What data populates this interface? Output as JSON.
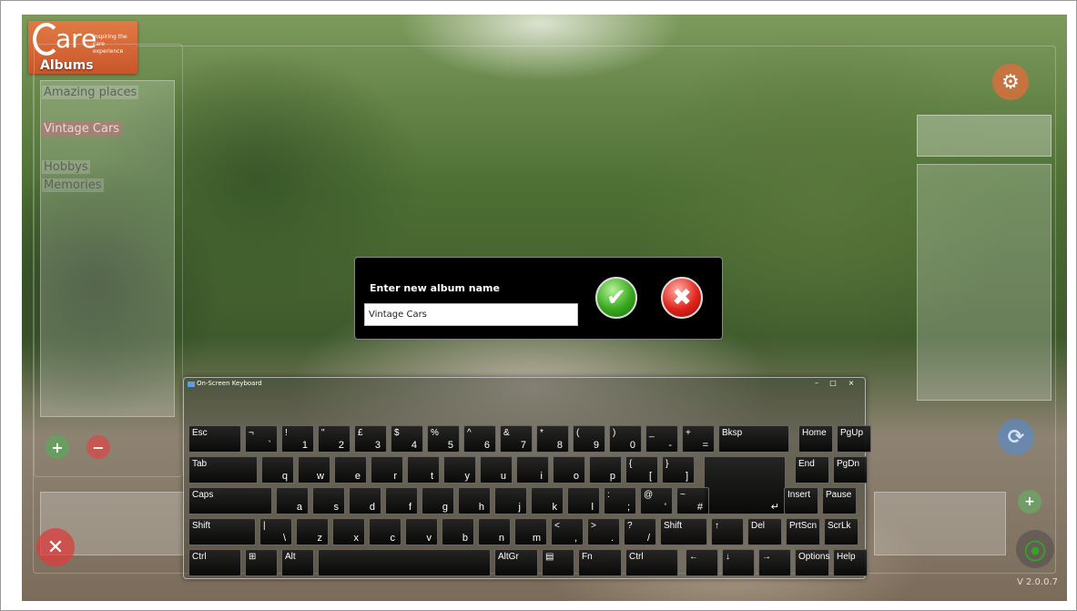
{
  "app": {
    "logo_word": "are",
    "logo_tagline": "inspiring the care experience",
    "albums_title": "Albums",
    "version": "V 2.0.0.7"
  },
  "albums": {
    "items": [
      "Amazing places",
      "Vintage Cars",
      "Hobbys",
      "Memories"
    ]
  },
  "dialog": {
    "title": "Enter new album name",
    "input_value": "Vintage Cars",
    "ok_icon": "checkmark-icon",
    "cancel_icon": "close-icon"
  },
  "osk": {
    "title": "On-Screen Keyboard",
    "controls": [
      "–",
      "□",
      "×"
    ],
    "rows": [
      [
        {
          "top": "Esc",
          "bottom": ""
        },
        {
          "top": "¬",
          "bottom": "`"
        },
        {
          "top": "!",
          "bottom": "1"
        },
        {
          "top": "\"",
          "bottom": "2"
        },
        {
          "top": "£",
          "bottom": "3"
        },
        {
          "top": "$",
          "bottom": "4"
        },
        {
          "top": "%",
          "bottom": "5"
        },
        {
          "top": "^",
          "bottom": "6"
        },
        {
          "top": "&",
          "bottom": "7"
        },
        {
          "top": "*",
          "bottom": "8"
        },
        {
          "top": "(",
          "bottom": "9"
        },
        {
          "top": ")",
          "bottom": "0"
        },
        {
          "top": "_",
          "bottom": "-"
        },
        {
          "top": "+",
          "bottom": "="
        },
        {
          "top": "Bksp",
          "bottom": ""
        },
        {
          "top": "Home",
          "bottom": ""
        },
        {
          "top": "PgUp",
          "bottom": ""
        }
      ],
      [
        {
          "top": "Tab",
          "bottom": ""
        },
        {
          "top": "",
          "bottom": "q"
        },
        {
          "top": "",
          "bottom": "w"
        },
        {
          "top": "",
          "bottom": "e"
        },
        {
          "top": "",
          "bottom": "r"
        },
        {
          "top": "",
          "bottom": "t"
        },
        {
          "top": "",
          "bottom": "y"
        },
        {
          "top": "",
          "bottom": "u"
        },
        {
          "top": "",
          "bottom": "i"
        },
        {
          "top": "",
          "bottom": "o"
        },
        {
          "top": "",
          "bottom": "p"
        },
        {
          "top": "{",
          "bottom": "["
        },
        {
          "top": "}",
          "bottom": "]"
        },
        {
          "top": "",
          "bottom": "↵"
        },
        {
          "top": "End",
          "bottom": ""
        },
        {
          "top": "PgDn",
          "bottom": ""
        }
      ],
      [
        {
          "top": "Caps",
          "bottom": ""
        },
        {
          "top": "",
          "bottom": "a"
        },
        {
          "top": "",
          "bottom": "s"
        },
        {
          "top": "",
          "bottom": "d"
        },
        {
          "top": "",
          "bottom": "f"
        },
        {
          "top": "",
          "bottom": "g"
        },
        {
          "top": "",
          "bottom": "h"
        },
        {
          "top": "",
          "bottom": "j"
        },
        {
          "top": "",
          "bottom": "k"
        },
        {
          "top": "",
          "bottom": "l"
        },
        {
          "top": ":",
          "bottom": ";"
        },
        {
          "top": "@",
          "bottom": "'"
        },
        {
          "top": "~",
          "bottom": "#"
        },
        {
          "top": "Insert",
          "bottom": ""
        },
        {
          "top": "Pause",
          "bottom": ""
        }
      ],
      [
        {
          "top": "Shift",
          "bottom": ""
        },
        {
          "top": "|",
          "bottom": "\\"
        },
        {
          "top": "",
          "bottom": "z"
        },
        {
          "top": "",
          "bottom": "x"
        },
        {
          "top": "",
          "bottom": "c"
        },
        {
          "top": "",
          "bottom": "v"
        },
        {
          "top": "",
          "bottom": "b"
        },
        {
          "top": "",
          "bottom": "n"
        },
        {
          "top": "",
          "bottom": "m"
        },
        {
          "top": "<",
          "bottom": ","
        },
        {
          "top": ">",
          "bottom": "."
        },
        {
          "top": "?",
          "bottom": "/"
        },
        {
          "top": "Shift",
          "bottom": ""
        },
        {
          "top": "↑",
          "bottom": ""
        },
        {
          "top": "Del",
          "bottom": ""
        },
        {
          "top": "PrtScn",
          "bottom": ""
        },
        {
          "top": "ScrLk",
          "bottom": ""
        }
      ],
      [
        {
          "top": "Ctrl",
          "bottom": ""
        },
        {
          "top": "⊞",
          "bottom": ""
        },
        {
          "top": "Alt",
          "bottom": ""
        },
        {
          "top": "",
          "bottom": ""
        },
        {
          "top": "AltGr",
          "bottom": ""
        },
        {
          "top": "▤",
          "bottom": ""
        },
        {
          "top": "Fn",
          "bottom": ""
        },
        {
          "top": "Ctrl",
          "bottom": ""
        },
        {
          "top": "←",
          "bottom": ""
        },
        {
          "top": "↓",
          "bottom": ""
        },
        {
          "top": "→",
          "bottom": ""
        },
        {
          "top": "Options",
          "bottom": ""
        },
        {
          "top": "Help",
          "bottom": ""
        }
      ]
    ]
  },
  "colors": {
    "dialog_bg": "#000000",
    "ok_green": "#38a81e",
    "cancel_red": "#e0241c",
    "logo_orange": "#d9663a"
  }
}
